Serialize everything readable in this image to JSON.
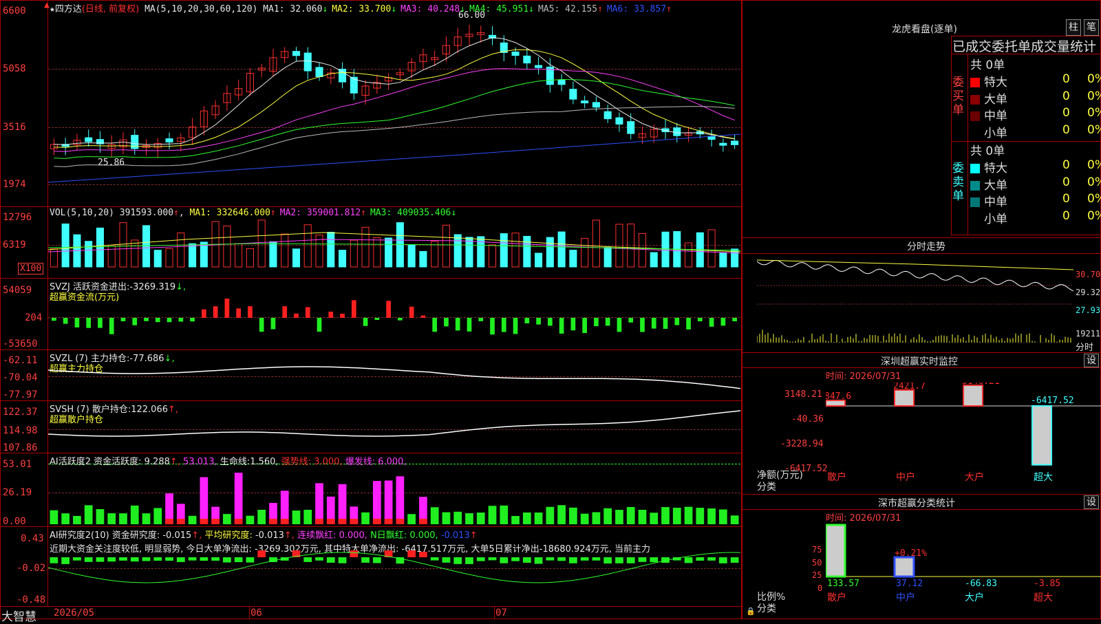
{
  "stock": {
    "name": "四方达",
    "mode": "(日线, 前复权)",
    "ma_header": "MA(5,10,20,30,60,120)",
    "ma": [
      {
        "label": "MA1:",
        "value": "32.060",
        "arrow": "↓",
        "color": "#e8e8e8"
      },
      {
        "label": "MA2:",
        "value": "33.700",
        "arrow": "↓",
        "color": "#ffff40"
      },
      {
        "label": "MA3:",
        "value": "40.248",
        "arrow": "↓",
        "color": "#ff40ff"
      },
      {
        "label": "MA4:",
        "value": "45.951",
        "arrow": "↓",
        "color": "#30ff30"
      },
      {
        "label": "MA5:",
        "value": "42.155",
        "arrow": "↑",
        "color": "#bbbbbb"
      },
      {
        "label": "MA6:",
        "value": "33.857",
        "arrow": "↑",
        "color": "#3050ff"
      }
    ],
    "price_axis": [
      "6600",
      "5058",
      "3516",
      "1974"
    ],
    "high_label": "66.00",
    "low_label": "25.86"
  },
  "vol": {
    "header": "VOL(5,10,20)",
    "value": "391593.000",
    "ma": [
      {
        "label": "MA1:",
        "value": "332646.000",
        "arrow": "↑",
        "color": "#ffff40"
      },
      {
        "label": "MA2:",
        "value": "359001.812",
        "arrow": "↑",
        "color": "#ff40ff"
      },
      {
        "label": "MA3:",
        "value": "409035.406",
        "arrow": "↓",
        "color": "#30ff30"
      }
    ],
    "axis": [
      "12796",
      "6319",
      "X100"
    ]
  },
  "svzj": {
    "header": "SVZJ  活跃资金进出:",
    "value": "-3269.319",
    "arrow": "↓,",
    "sub": "超赢资金流(万元)",
    "axis": [
      "54059",
      "204",
      "-53650"
    ]
  },
  "svzl": {
    "header": "SVZL (7) 主力持仓:",
    "value": "-77.686",
    "arrow": "↓,",
    "sub": "超赢主力持仓",
    "axis": [
      "-62.11",
      "-70.04",
      "-77.97"
    ]
  },
  "svsh": {
    "header": "SVSH (7) 散户持仓:",
    "value": "122.066",
    "arrow": "↑,",
    "sub": "超赢散户持仓",
    "axis": [
      "122.37",
      "114.98",
      "107.86"
    ]
  },
  "ai1": {
    "header": "AI活跃度2 资金活跃度:",
    "value": "9.288",
    "val2": "53.013,",
    "life_label": "生命线:",
    "life_value": "1.560,",
    "strong": "强势线: 3.000,",
    "burst": "爆发线: 6.000,",
    "axis": [
      "53.01",
      "26.19",
      "0.00"
    ]
  },
  "ai2": {
    "header": "AI研究度2(10) 资金研究度:",
    "value": "-0.015",
    "avg_label": "平均研究度:",
    "avg_value": "-0.013",
    "cont_label": "连续飘红: 0.000,",
    "nday_label": "N日飘红: 0.000,",
    "tail": "-0.013",
    "commentary": "近期大资金关注度较低, 明显弱势, 今日大单净流出: -3269.302万元, 其中特大单净流出: -6417.517万元, 大单5日累计净出-18680.924万元, 当前主力",
    "axis": [
      "0.43",
      "-0.02",
      "-0.48"
    ]
  },
  "dates": {
    "d1": "2026/05",
    "d2": "06",
    "d3": "07"
  },
  "logo": "大智慧",
  "right": {
    "lhb_title": "龙虎看盘(逐单)",
    "btn_zhu": "柱",
    "btn_bi": "笔",
    "section_title": "已成交委托单成交量统计",
    "buy": {
      "side": "委买单",
      "total": "共 0单",
      "rows": [
        {
          "label": "特大",
          "v": "0",
          "p": "0%",
          "color": "#ff0000"
        },
        {
          "label": "大单",
          "v": "0",
          "p": "0%",
          "color": "#8b0000"
        },
        {
          "label": "中单",
          "v": "0",
          "p": "0%",
          "color": "#6b0000"
        },
        {
          "label": "小单",
          "v": "0",
          "p": "0%",
          "color": ""
        }
      ]
    },
    "sell": {
      "side": "委卖单",
      "total": "共 0单",
      "rows": [
        {
          "label": "特大",
          "v": "0",
          "p": "0%",
          "color": "#00ffff"
        },
        {
          "label": "大单",
          "v": "0",
          "p": "0%",
          "color": "#008b8b"
        },
        {
          "label": "中单",
          "v": "0",
          "p": "0%",
          "color": "#007777"
        },
        {
          "label": "小单",
          "v": "0",
          "p": "0%",
          "color": ""
        }
      ]
    },
    "timeshare": {
      "title": "分时走势",
      "axis": [
        "30.70",
        "29.32",
        "27.93"
      ],
      "vol_label": "19211",
      "vol_unit": "分时"
    },
    "sz_monitor": {
      "title": "深圳超赢实时监控",
      "btn": "设",
      "time": "时间: 2026/07/31",
      "axis": [
        "3148.21",
        "-40.36",
        "-3228.94",
        "-6417.52"
      ],
      "unit": "净额(万元)",
      "cat_label": "分类",
      "categories": [
        "散户",
        "中户",
        "大户",
        "超大"
      ],
      "values": [
        "847.6",
        "2421.7",
        "3148.21",
        "-6417.52"
      ]
    },
    "sz_class": {
      "title": "深市超赢分类统计",
      "btn": "设",
      "time": "时间: 2026/07/31",
      "axis": [
        "75",
        "50",
        "25",
        "0"
      ],
      "unit": "比例%",
      "cat_label": "分类",
      "categories": [
        "散户",
        "中户",
        "大户",
        "超大"
      ],
      "values": [
        "133.57",
        "37.12",
        "-66.83",
        "-3.85"
      ],
      "pct_label": "+0.21%"
    }
  }
}
